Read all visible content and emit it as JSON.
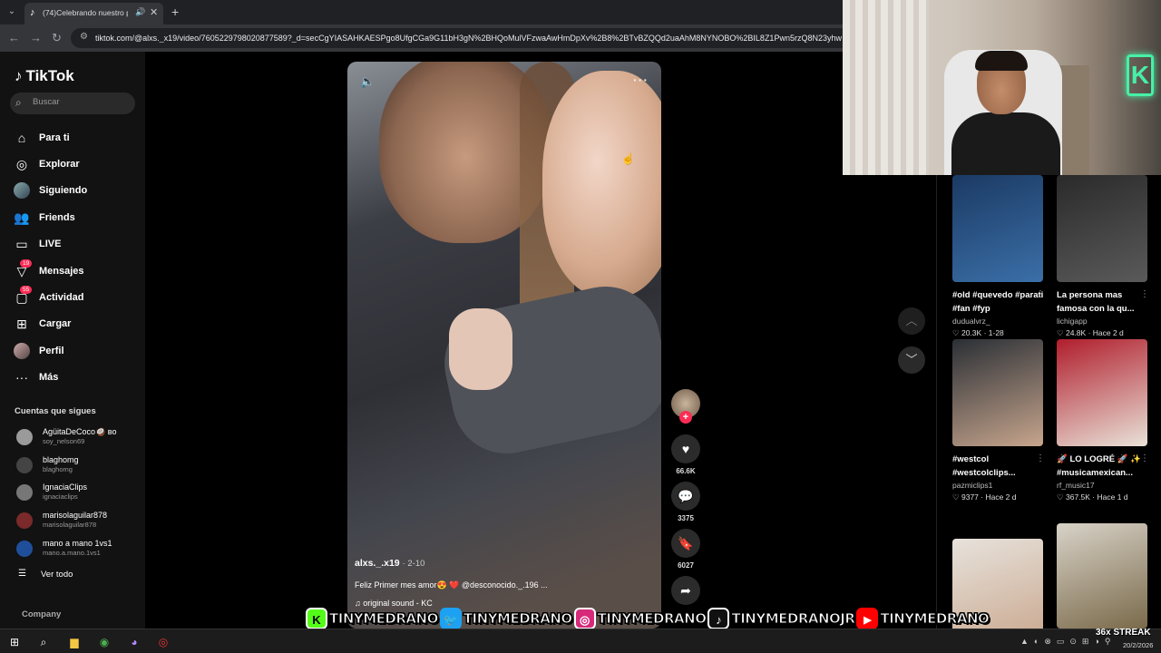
{
  "browser": {
    "tab_title": "(74)Celebrando nuestro pri...",
    "url": "tiktok.com/@alxs._x19/video/7605229798020877589?_d=secCgYIASAHKAESPgo8UfgCGa9G11bH3gN%2BHQoMulVFzwaAwHmDpXv%2B8%2BTvBZQQd2uaAhM8NYNOBO%2BIL8Z1Pwn5rzQ8N23yhw"
  },
  "sidebar": {
    "brand": "TikTok",
    "search_placeholder": "Buscar",
    "nav": [
      {
        "label": "Para ti",
        "icon": "home-icon"
      },
      {
        "label": "Explorar",
        "icon": "compass-icon"
      },
      {
        "label": "Siguiendo",
        "icon": "following-avatar-icon"
      },
      {
        "label": "Friends",
        "icon": "friends-icon"
      },
      {
        "label": "LIVE",
        "icon": "live-icon"
      },
      {
        "label": "Mensajes",
        "icon": "messages-icon",
        "badge": "19"
      },
      {
        "label": "Actividad",
        "icon": "activity-icon",
        "badge": "55"
      },
      {
        "label": "Cargar",
        "icon": "upload-icon"
      },
      {
        "label": "Perfil",
        "icon": "profile-avatar-icon"
      },
      {
        "label": "Más",
        "icon": "more-dots-icon"
      }
    ],
    "following_title": "Cuentas que sigues",
    "following": [
      {
        "name": "AgüitaDeCoco🥥 ʙᴏ",
        "handle": "soy_nelson69",
        "color": "#9a9a9a"
      },
      {
        "name": "blaghomg",
        "handle": "blaghomg",
        "color": "#444444"
      },
      {
        "name": "IgnaciaClips",
        "handle": "ignaciaclips",
        "color": "#777777"
      },
      {
        "name": "marisolaguilar878",
        "handle": "marisolaguilar878",
        "color": "#7a2a2a"
      },
      {
        "name": "mano a mano 1vs1",
        "handle": "mano.a.mano.1vs1",
        "color": "#1f4f9a"
      }
    ],
    "see_all": "Ver todo",
    "company": "Company"
  },
  "video": {
    "author": "alxs._.x19",
    "date": "2-10",
    "caption": "Feliz Primer mes amor😍 ❤️ @desconocido._.196 ...",
    "sound": "original sound - KC",
    "likes": "66.6K",
    "comments": "3375",
    "saves": "6027"
  },
  "recommendations": [
    {
      "caption": "#old #quevedo #parati #fan #fyp",
      "author": "dudualvrz_",
      "likes": "20.3K",
      "date": "1-28",
      "colors": [
        "#1b3a63",
        "#3b6fa8"
      ]
    },
    {
      "caption": "La persona mas famosa con la qu...",
      "author": "lichigapp",
      "likes": "24.8K",
      "date": "Hace 2 d",
      "colors": [
        "#2a2a2a",
        "#5a5a5a"
      ]
    },
    {
      "caption": "#westcol #westcolclips...",
      "author": "pazmiclips1",
      "likes": "9377",
      "date": "Hace 2 d",
      "colors": [
        "#2a2f35",
        "#c7a58d"
      ]
    },
    {
      "caption": "🚀 LO LOGRÉ 🚀 ✨ #musicamexican...",
      "author": "rf_music17",
      "likes": "367.5K",
      "date": "Hace 1 d",
      "colors": [
        "#b01d2c",
        "#e9e2d8"
      ]
    },
    {
      "caption": "",
      "author": "",
      "likes": "",
      "date": "",
      "colors": [
        "#e7e2dc",
        "#c9a78d"
      ]
    },
    {
      "caption": "",
      "author": "",
      "likes": "",
      "date": "",
      "colors": [
        "#d8d2c8",
        "#7a6a4a"
      ]
    }
  ],
  "social": [
    {
      "platform": "kick",
      "icon": "kick-icon",
      "glyph": "K",
      "color": "#53fc18",
      "name": "TINYMEDRANO"
    },
    {
      "platform": "twitter",
      "icon": "twitter-icon",
      "glyph": "🐦",
      "color": "#1da1f2",
      "name": "TINYMEDRANO"
    },
    {
      "platform": "instagram",
      "icon": "instagram-icon",
      "glyph": "◎",
      "color": "#d6297a",
      "name": "TINYMEDRANO"
    },
    {
      "platform": "tiktok",
      "icon": "tiktok-icon",
      "glyph": "♪",
      "color": "#111111",
      "name": "TINYMEDRANOJR"
    },
    {
      "platform": "youtube",
      "icon": "youtube-icon",
      "glyph": "▶",
      "color": "#ff0000",
      "name": "TINYMEDRANO"
    }
  ],
  "overlay": {
    "streak": "36x STREAK",
    "date": "20/2/2026"
  }
}
